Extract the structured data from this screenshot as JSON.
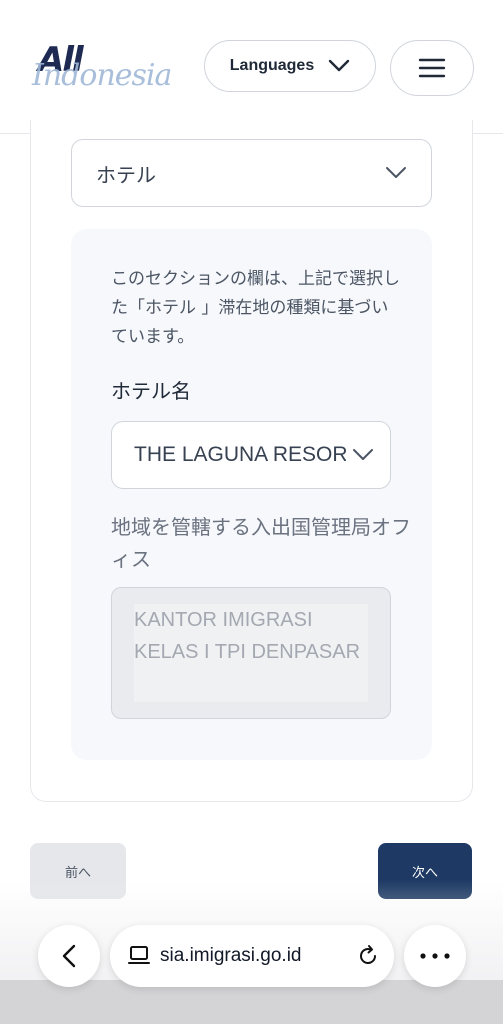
{
  "header": {
    "logo_all": "All",
    "logo_indonesia": "Indonesia",
    "language_label": "Languages"
  },
  "form": {
    "accommodation_type_value": "ホテル",
    "panel_note": "このセクションの欄は、上記で選択した「ホテル 」滞在地の種類に基づいています。",
    "hotel_name_label": "ホテル名",
    "hotel_name_value": "THE LAGUNA RESORT",
    "office_label": "地域を管轄する入出国管理局オフィス",
    "office_value": "KANTOR IMIGRASI KELAS I TPI DENPASAR"
  },
  "nav": {
    "prev_label": "前へ",
    "next_label": "次へ"
  },
  "browser": {
    "url": "sia.imigrasi.go.id"
  },
  "colors": {
    "brand_navy": "#1e3a64",
    "logo_light": "#9fb7d6"
  }
}
